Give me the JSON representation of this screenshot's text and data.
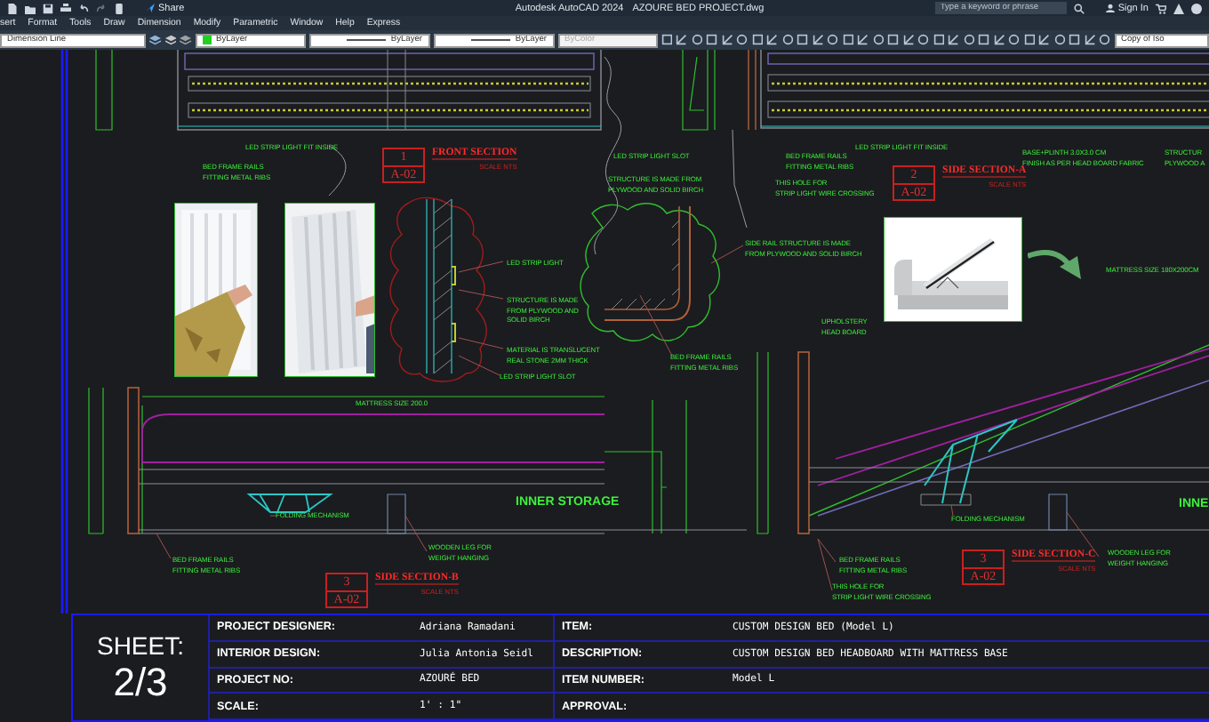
{
  "title_bar": {
    "share": "Share",
    "app": "Autodesk AutoCAD 2024",
    "file": "AZOURE BED PROJECT.dwg",
    "search": {
      "placeholder": "Type a keyword or phrase"
    },
    "sign_in": "Sign In"
  },
  "menu": [
    "sert",
    "Format",
    "Tools",
    "Draw",
    "Dimension",
    "Modify",
    "Parametric",
    "Window",
    "Help",
    "Express"
  ],
  "properties_bar": {
    "dimension_style": "Dimension Line",
    "color_setting": "ByLayer",
    "linetype": "ByLayer",
    "lineweight": "ByLayer",
    "plot_style": {
      "value": "ByColor",
      "disabled": true
    },
    "view": "Copy of Iso"
  },
  "drawing": {
    "section_tags": [
      {
        "number": "1",
        "sheet": "A-02",
        "title": "FRONT SECTION",
        "scale": "SCALE NTS"
      },
      {
        "number": "2",
        "sheet": "A-02",
        "title": "SIDE SECTION-A",
        "scale": "SCALE NTS"
      },
      {
        "number": "3",
        "sheet": "A-02",
        "title": "SIDE SECTION-B",
        "scale": "SCALE NTS"
      },
      {
        "number": "3",
        "sheet": "A-02",
        "title": "SIDE SECTION-C",
        "scale": "SCALE NTS"
      }
    ],
    "notes": [
      {
        "kind": "note",
        "lines": [
          "LED STRIP LIGHT FIT INSIDE"
        ]
      },
      {
        "kind": "note",
        "lines": [
          "BED FRAME RAILS",
          "FITTING METAL RIBS"
        ]
      },
      {
        "kind": "note",
        "lines": [
          "LED STRIP LIGHT"
        ]
      },
      {
        "kind": "note",
        "lines": [
          "STRUCTURE IS MADE",
          "FROM PLYWOOD AND",
          "SOLID BIRCH"
        ]
      },
      {
        "kind": "note",
        "lines": [
          "MATERIAL IS TRANSLUCENT",
          "REAL STONE 2MM THICK"
        ]
      },
      {
        "kind": "note",
        "lines": [
          "LED STRIP LIGHT SLOT"
        ]
      },
      {
        "kind": "note",
        "lines": [
          "LED STRIP LIGHT SLOT"
        ]
      },
      {
        "kind": "note",
        "lines": [
          "STRUCTURE IS MADE FROM",
          "PLYWOOD AND SOLID BIRCH"
        ]
      },
      {
        "kind": "note",
        "lines": [
          "BED FRAME RAILS",
          "FITTING METAL RIBS"
        ]
      },
      {
        "kind": "note",
        "lines": [
          "THIS HOLE FOR",
          "STRIP LIGHT WIRE CROSSING"
        ]
      },
      {
        "kind": "note",
        "lines": [
          "LED STRIP LIGHT FIT INSIDE"
        ]
      },
      {
        "kind": "note",
        "lines": [
          "BASE+PLINTH 3.0X3.0 CM",
          "FINISH AS PER HEAD BOARD FABRIC"
        ]
      },
      {
        "kind": "note",
        "lines": [
          "STRUCTUR",
          "PLYWOOD A"
        ]
      },
      {
        "kind": "note",
        "lines": [
          "SIDE RAIL STRUCTURE IS MADE",
          "FROM PLYWOOD AND SOLID BIRCH"
        ]
      },
      {
        "kind": "note",
        "lines": [
          "UPHOLSTERY",
          "HEAD BOARD"
        ]
      },
      {
        "kind": "note",
        "lines": [
          "BED FRAME RAILS",
          "FITTING METAL RIBS"
        ]
      },
      {
        "kind": "note",
        "lines": [
          "MATTRESS SIZE 180X200CM"
        ]
      },
      {
        "kind": "note",
        "lines": [
          "MATTRESS SIZE 200.0"
        ]
      },
      {
        "kind": "heading",
        "lines": [
          "INNER STORAGE"
        ]
      },
      {
        "kind": "note",
        "lines": [
          "FOLDING MECHANISM"
        ]
      },
      {
        "kind": "note",
        "lines": [
          "WOODEN LEG FOR",
          "WEIGHT HANGING"
        ]
      },
      {
        "kind": "note",
        "lines": [
          "BED FRAME RAILS",
          "FITTING METAL RIBS"
        ]
      },
      {
        "kind": "note",
        "lines": [
          "FOLDING MECHANISM"
        ]
      },
      {
        "kind": "note",
        "lines": [
          "WOODEN LEG FOR",
          "WEIGHT HANGING"
        ]
      },
      {
        "kind": "note",
        "lines": [
          "BED FRAME RAILS",
          "FITTING METAL RIBS"
        ]
      },
      {
        "kind": "note",
        "lines": [
          "THIS HOLE FOR",
          "STRIP LIGHT WIRE CROSSING"
        ]
      },
      {
        "kind": "heading",
        "lines": [
          "INNE"
        ]
      }
    ]
  },
  "title_block": {
    "sheet_label": "SHEET:",
    "sheet": "2/3",
    "left_fields": [
      {
        "label": "PROJECT DESIGNER:",
        "value": "Adriana Ramadani"
      },
      {
        "label": "INTERIOR DESIGN:",
        "value": "Julia Antonia Seidl"
      },
      {
        "label": "PROJECT NO:",
        "value": "AZOURÉ BED"
      },
      {
        "label": "SCALE:",
        "value": "1' : 1\""
      }
    ],
    "right_fields": [
      {
        "label": "ITEM:",
        "value": "CUSTOM DESIGN BED (Model L)"
      },
      {
        "label": "DESCRIPTION:",
        "value": "CUSTOM DESIGN BED HEADBOARD WITH MATTRESS BASE"
      },
      {
        "label": "ITEM NUMBER:",
        "value": "Model L"
      },
      {
        "label": "APPROVAL:"
      }
    ]
  }
}
